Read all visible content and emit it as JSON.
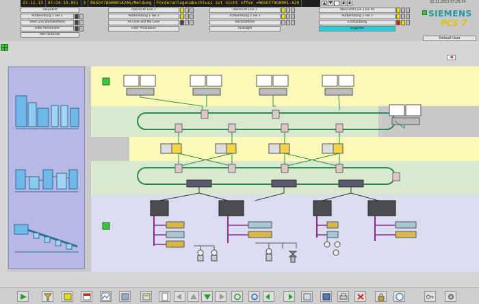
{
  "alarm_line": {
    "date": "22.11.13",
    "time": "07:24:19.051",
    "count": "3",
    "tag": "R6SGY78GH001A20G/Meldung",
    "message": "Förderanlagenabschluss ist nicht offen =R6SGY78GH001-A20"
  },
  "system": {
    "datetime": "22.11.2013 07:25:34",
    "brand": "SIEMENS",
    "product": "PCS 7",
    "user": "Default User"
  },
  "areas": [
    [
      "Hauptbild",
      "Aufbereitung 1 Teil 1",
      "Vlieh und Stärkelöfflese",
      "Filter Permanent",
      "AW-Container"
    ],
    [
      "Übersicht Line 1",
      "Aufbereitung 1 Teil 2",
      "Fe Linie und ME Linie",
      "Filter Produktion"
    ],
    [
      "Übersicht Line 3",
      "Aufbereitung 2 Teil 1",
      "Reststofflinie",
      "Tanklager"
    ],
    [
      "Übersicht Line 3 bis 90",
      "Aufbereitung 2 Teil 3",
      "Entstaubung",
      "Diagnose"
    ]
  ],
  "active_area": "Diagnose",
  "colors": {
    "yellow_zone": "#fbf8b8",
    "green_zone": "#d9e9cf",
    "gray_zone": "#c8c8c8",
    "lavender_zone": "#dcdcf3",
    "ring": "#2b8c52",
    "status_ok": "#38c838",
    "active_tab": "#22d3dd"
  },
  "icons": {
    "left_panel": [
      "plant-overview-icon",
      "process-line-icon",
      "conveyor-icon"
    ],
    "toolbar": [
      "play-icon",
      "filter-icon",
      "alarm-list-icon",
      "message-list-icon",
      "diagnostic-icon",
      "trend-icon",
      "faceplate-icon",
      "report-icon",
      "arrow-left-icon",
      "arrow-up-icon",
      "arrow-down-icon",
      "arrow-right-icon",
      "loop-icon",
      "refresh-icon",
      "back-icon",
      "forward-icon",
      "picture-icon",
      "save-icon",
      "print-icon",
      "delete-icon",
      "lock-icon",
      "info-icon",
      "key-icon",
      "settings-icon"
    ]
  }
}
